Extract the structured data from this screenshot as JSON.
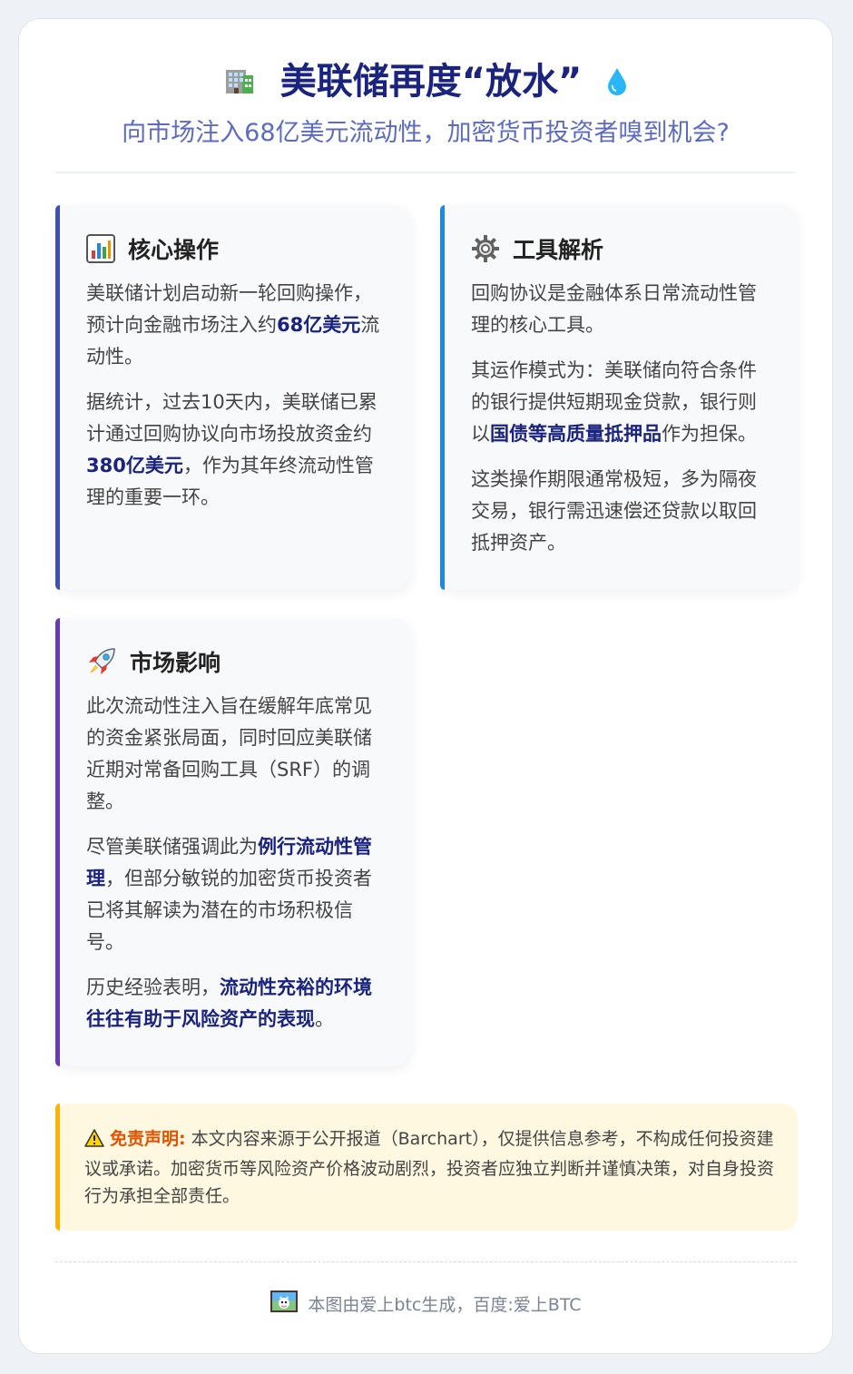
{
  "header": {
    "title": "美联储再度“放水”",
    "title_icon": "office-building-icon",
    "title_suffix_icon": "water-drop-icon",
    "subtitle": "向市场注入68亿美元流动性，加密货币投资者嗅到机会?"
  },
  "cards": [
    {
      "title": "核心操作",
      "icon": "bar-chart-icon",
      "accent": "#3f51b5",
      "p1": [
        "美联储计划启动新一轮回购操作，预计向金融市场注入约",
        "68亿美元",
        "流动性。"
      ],
      "p2": [
        "据统计，过去10天内，美联储已累计通过回购协议向市场投放资金约",
        "380亿美元",
        "，作为其年终流动性管理的重要一环。"
      ]
    },
    {
      "title": "工具解析",
      "icon": "gear-icon",
      "accent": "#1e88e5",
      "p1": "回购协议是金融体系日常流动性管理的核心工具。",
      "p2": [
        "其运作模式为：美联储向符合条件的银行提供短期现金贷款，银行则以",
        "国债等高质量抵押品",
        "作为担保。"
      ],
      "p3": "这类操作期限通常极短，多为隔夜交易，银行需迅速偿还贷款以取回抵押资产。"
    },
    {
      "title": "市场影响",
      "icon": "rocket-icon",
      "accent": "#673ab7",
      "p1": "此次流动性注入旨在缓解年底常见的资金紧张局面，同时回应美联储近期对常备回购工具（SRF）的调整。",
      "p2": [
        "尽管美联储强调此为",
        "例行流动性管理",
        "，但部分敏锐的加密货币投资者已将其解读为潜在的市场积极信号。"
      ],
      "p3": [
        "历史经验表明，",
        "流动性充裕的环境往往有助于风险资产的表现",
        "。"
      ]
    }
  ],
  "disclaimer": {
    "icon": "warning-icon",
    "label": "免责声明:",
    "text": "本文内容来源于公开报道（Barchart），仅提供信息参考，不构成任何投资建议或承诺。加密货币等风险资产价格波动剧烈，投资者应独立判断并谨慎决策，对自身投资行为承担全部责任。"
  },
  "footer": {
    "icon": "app-logo-icon",
    "text": "本图由爱上btc生成，百度:爱上BTC"
  },
  "colors": {
    "title": "#1a237e",
    "subtitle": "#5c6bc0",
    "highlight": "#1a237e",
    "disclaimer_bg": "#fff8e1",
    "disclaimer_accent": "#ffb300",
    "disclaimer_label": "#e65100"
  }
}
